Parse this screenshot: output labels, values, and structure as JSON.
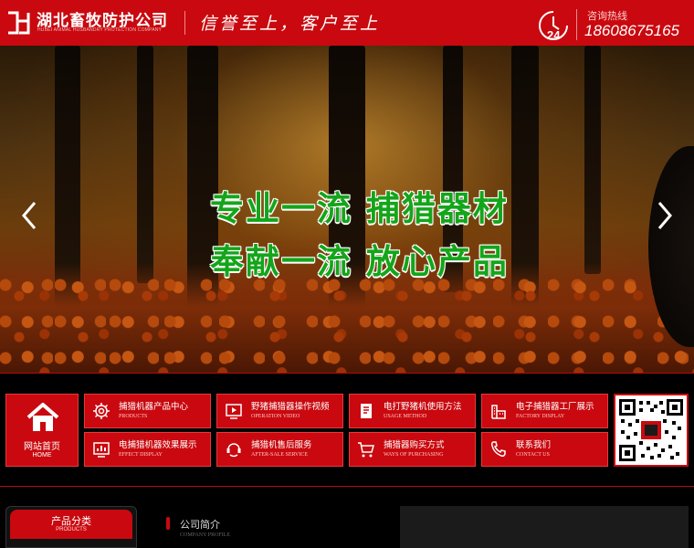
{
  "header": {
    "company_name": "湖北畜牧防护公司",
    "company_name_en": "HUBEI ANIMAL HUSBANDRY PROTECTION COMPANY",
    "slogan": "信誉至上，客户至上",
    "hotline_badge": "24",
    "hotline_label": "咨询热线",
    "hotline_number": "18608675165"
  },
  "banner": {
    "line1": "专业一流  捕猎器材",
    "line2": "奉献一流  放心产品"
  },
  "nav": {
    "home": {
      "label": "网站首页",
      "sub": "HOME"
    },
    "items": [
      {
        "label": "捕猎机器产品中心",
        "sub": "PRODUCTS",
        "icon": "gear-icon"
      },
      {
        "label": "野猪捕猎器操作视频",
        "sub": "OPERATION VIDEO",
        "icon": "video-icon"
      },
      {
        "label": "电打野猪机使用方法",
        "sub": "USAGE METHOD",
        "icon": "document-icon"
      },
      {
        "label": "电子捕猎器工厂展示",
        "sub": "FACTORY DISPLAY",
        "icon": "factory-icon"
      },
      {
        "label": "电捕猎机器效果展示",
        "sub": "EFFECT DISPLAY",
        "icon": "chart-icon"
      },
      {
        "label": "捕猎机售后服务",
        "sub": "AFTER-SALE SERVICE",
        "icon": "service-icon"
      },
      {
        "label": "捕猎器购买方式",
        "sub": "WAYS OF PURCHASING",
        "icon": "cart-icon"
      },
      {
        "label": "联系我们",
        "sub": "CONTACT US",
        "icon": "phone-icon"
      }
    ]
  },
  "sidebar": {
    "title": "产品分类",
    "sub": "PRODUCTS"
  },
  "about": {
    "title": "公司简介",
    "sub": "COMPANY PROFILE"
  },
  "colors": {
    "brand_red": "#c9090f",
    "banner_green": "#14a51a"
  }
}
